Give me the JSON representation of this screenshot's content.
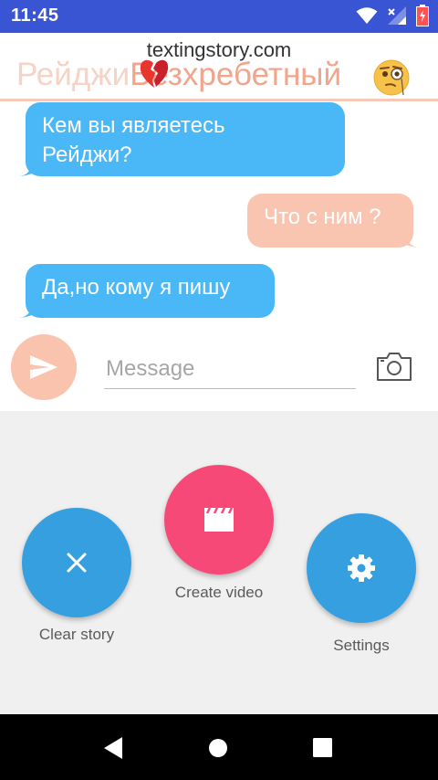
{
  "status_bar": {
    "time": "11:45",
    "icons": [
      "wifi-icon",
      "signal-icon",
      "battery-icon"
    ],
    "color": "#3a55d4"
  },
  "header": {
    "watermark": "textingstory.com",
    "contact_name_part1": "Рейджи",
    "contact_name_part2": "Безхребетный",
    "emoji_1": "broken-heart-icon",
    "emoji_2": "monocle-face-icon"
  },
  "messages": [
    {
      "side": "left",
      "line1": "Кем вы являетесь",
      "line2": "Рейджи?"
    },
    {
      "side": "right",
      "text": "Что с ним ?"
    },
    {
      "side": "left",
      "text": "Да,но кому я пишу"
    }
  ],
  "composer": {
    "placeholder": "Message",
    "send_icon": "send-icon",
    "camera_icon": "camera-icon"
  },
  "actions": {
    "clear_label": "Clear story",
    "create_label": "Create video",
    "settings_label": "Settings",
    "blue": "#359fe0",
    "pink": "#f74978"
  },
  "colors": {
    "left_bubble": "#4ab7f7",
    "right_bubble": "#f9c5b1",
    "accent": "#f0a58c"
  }
}
